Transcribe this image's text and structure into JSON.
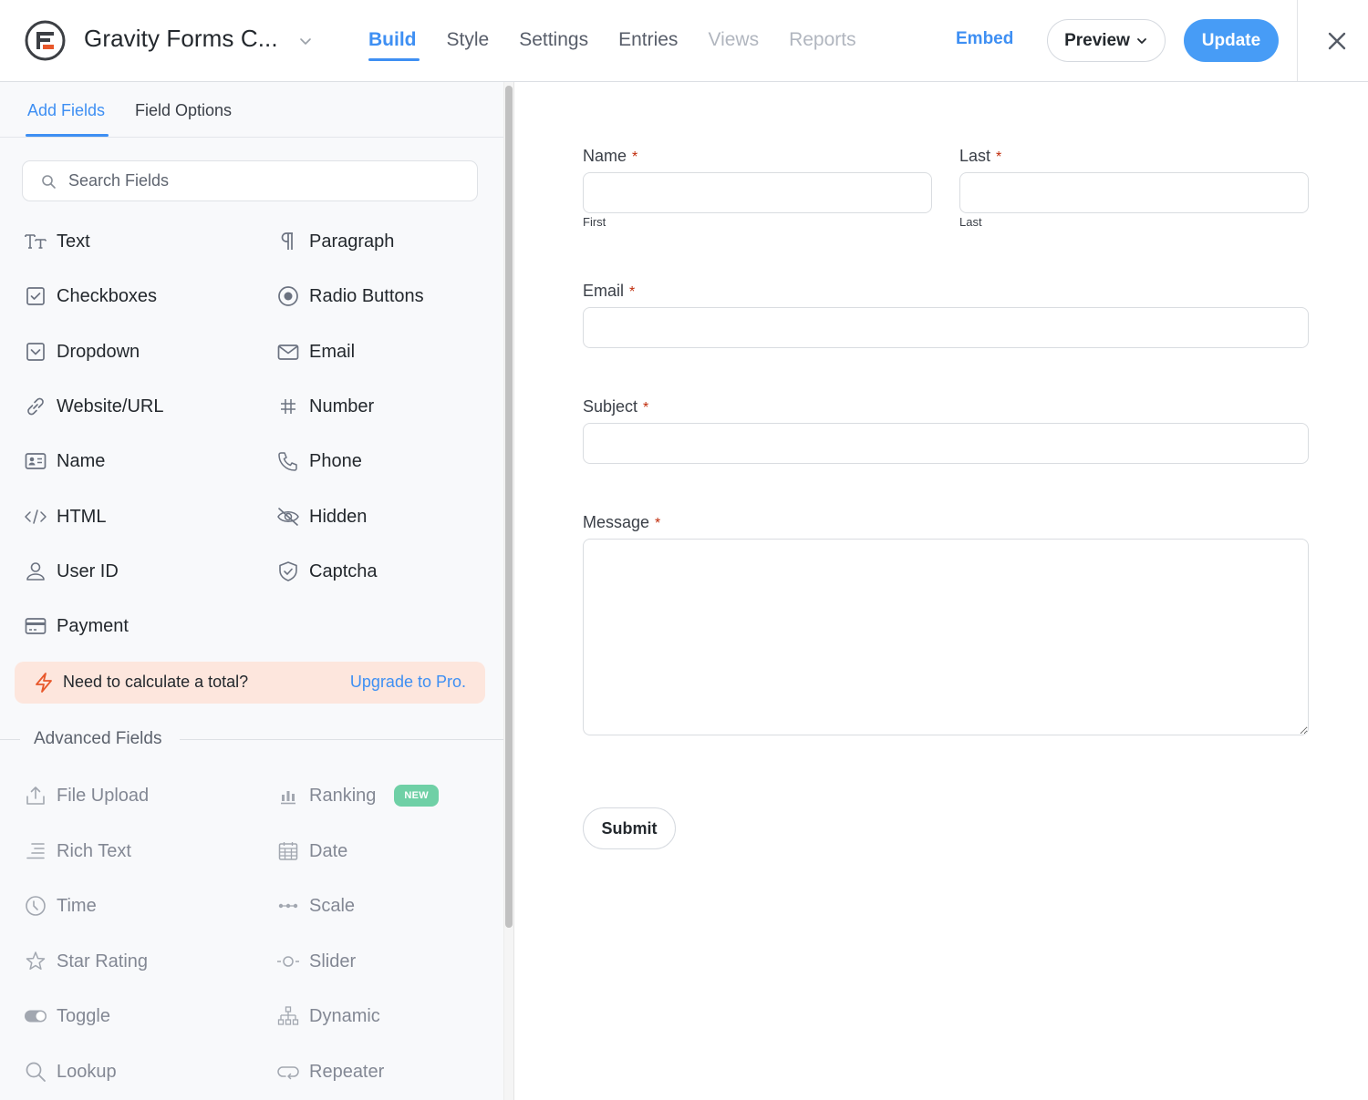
{
  "header": {
    "form_title": "Gravity Forms C...",
    "nav": [
      {
        "label": "Build",
        "state": "active"
      },
      {
        "label": "Style",
        "state": "normal"
      },
      {
        "label": "Settings",
        "state": "normal"
      },
      {
        "label": "Entries",
        "state": "normal"
      },
      {
        "label": "Views",
        "state": "disabled"
      },
      {
        "label": "Reports",
        "state": "disabled"
      }
    ],
    "embed_label": "Embed",
    "preview_label": "Preview",
    "update_label": "Update",
    "accent_color": "#3e8ff3"
  },
  "sidebar": {
    "tabs": [
      {
        "label": "Add Fields",
        "active": true
      },
      {
        "label": "Field Options",
        "active": false
      }
    ],
    "search": {
      "placeholder": "Search Fields",
      "value": ""
    },
    "standard_fields": [
      {
        "label": "Text",
        "icon": "text-icon"
      },
      {
        "label": "Paragraph",
        "icon": "paragraph-icon"
      },
      {
        "label": "Checkboxes",
        "icon": "checkbox-icon"
      },
      {
        "label": "Radio Buttons",
        "icon": "radio-icon"
      },
      {
        "label": "Dropdown",
        "icon": "dropdown-icon"
      },
      {
        "label": "Email",
        "icon": "email-icon"
      },
      {
        "label": "Website/URL",
        "icon": "link-icon"
      },
      {
        "label": "Number",
        "icon": "hash-icon"
      },
      {
        "label": "Name",
        "icon": "id-card-icon"
      },
      {
        "label": "Phone",
        "icon": "phone-icon"
      },
      {
        "label": "HTML",
        "icon": "code-icon"
      },
      {
        "label": "Hidden",
        "icon": "eye-slash-icon"
      },
      {
        "label": "User ID",
        "icon": "user-icon"
      },
      {
        "label": "Captcha",
        "icon": "shield-check-icon"
      },
      {
        "label": "Payment",
        "icon": "credit-card-icon"
      }
    ],
    "promo": {
      "text": "Need to calculate a total?",
      "link": "Upgrade to Pro.",
      "background": "#fde6dd",
      "icon_color": "#e8572a"
    },
    "advanced_heading": "Advanced Fields",
    "advanced_fields": [
      {
        "label": "File Upload",
        "icon": "upload-icon"
      },
      {
        "label": "Ranking",
        "icon": "bar-chart-icon",
        "badge": "NEW"
      },
      {
        "label": "Rich Text",
        "icon": "align-right-icon"
      },
      {
        "label": "Date",
        "icon": "calendar-icon"
      },
      {
        "label": "Time",
        "icon": "clock-icon"
      },
      {
        "label": "Scale",
        "icon": "scale-dots-icon"
      },
      {
        "label": "Star Rating",
        "icon": "star-icon"
      },
      {
        "label": "Slider",
        "icon": "slider-icon"
      },
      {
        "label": "Toggle",
        "icon": "toggle-icon"
      },
      {
        "label": "Dynamic",
        "icon": "hierarchy-icon"
      },
      {
        "label": "Lookup",
        "icon": "search-icon"
      },
      {
        "label": "Repeater",
        "icon": "repeat-icon"
      }
    ]
  },
  "form": {
    "name": {
      "label": "Name",
      "required_mark": "*",
      "first_sublabel": "First",
      "first_value": ""
    },
    "last": {
      "label": "Last",
      "required_mark": "*",
      "sublabel": "Last",
      "value": ""
    },
    "email": {
      "label": "Email",
      "required_mark": "*",
      "value": ""
    },
    "subject": {
      "label": "Subject",
      "required_mark": "*",
      "value": ""
    },
    "message": {
      "label": "Message",
      "required_mark": "*",
      "value": ""
    },
    "submit_label": "Submit",
    "required_color": "#c02b0a"
  }
}
